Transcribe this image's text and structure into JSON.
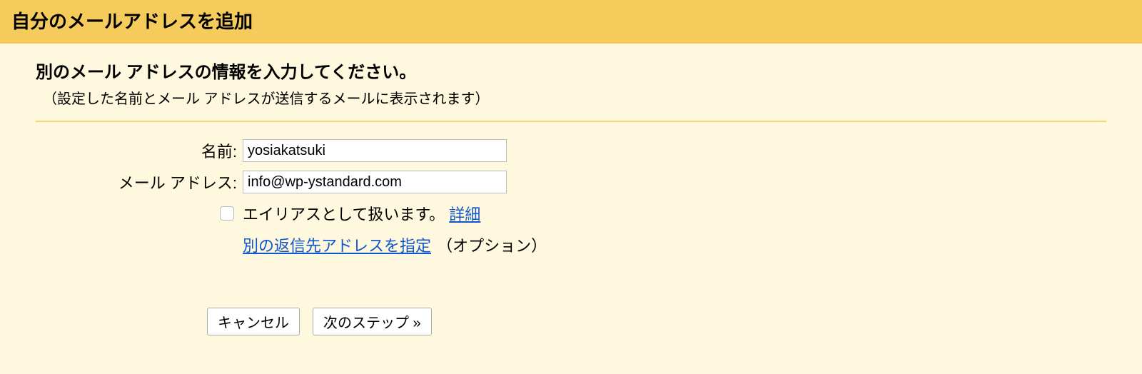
{
  "header": {
    "title": "自分のメールアドレスを追加"
  },
  "section": {
    "subtitle": "別のメール アドレスの情報を入力してください。",
    "note": "（設定した名前とメール アドレスが送信するメールに表示されます）"
  },
  "form": {
    "name_label": "名前:",
    "name_value": "yosiakatsuki",
    "email_label": "メール アドレス:",
    "email_value": "info@wp-ystandard.com",
    "alias_label": "エイリアスとして扱います。",
    "alias_detail_link": "詳細",
    "reply_to_link": "別の返信先アドレスを指定",
    "reply_to_option": "（オプション）"
  },
  "buttons": {
    "cancel": "キャンセル",
    "next": "次のステップ »"
  }
}
